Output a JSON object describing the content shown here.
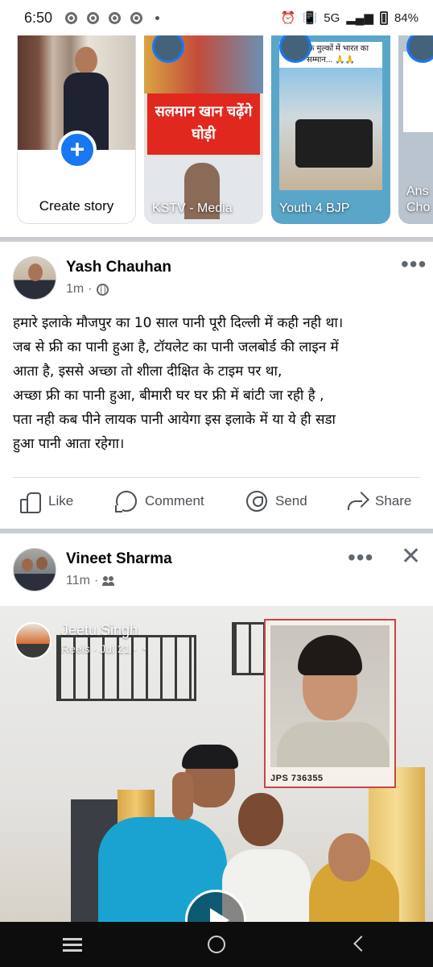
{
  "status_bar": {
    "time": "6:50",
    "network": "5G",
    "battery": "84%"
  },
  "stories": {
    "create_label": "Create story",
    "items": [
      {
        "name": "KSTV - Media",
        "banner": "सलमान खान चढ़ेंगे घोड़ी"
      },
      {
        "name": "Youth 4 BJP",
        "caption": "शहर के मुल्कों में भारत का सम्मान... 🙏🙏"
      },
      {
        "name": "Ans Cho"
      }
    ]
  },
  "posts": [
    {
      "author": "Yash Chauhan",
      "time": "1m",
      "privacy_icon": "globe-icon",
      "lines": [
        "हमारे इलाके मौजपुर का 10 साल पानी पूरी दिल्ली में कही नही था।",
        "जब से फ्री का पानी हुआ है, टॉयलेट का पानी जलबोर्ड की लाइन में",
        "आता है, इससे अच्छा तो शीला दीक्षित के टाइम पर था,",
        "अच्छा फ्री का पानी हुआ, बीमारी घर घर फ्री में बांटी जा रही है ,",
        "पता नही कब पीने लायक पानी आयेगा इस इलाके में या ये ही सडा",
        "हुआ पानी आता रहेगा।"
      ],
      "actions": {
        "like": "Like",
        "comment": "Comment",
        "send": "Send",
        "share": "Share"
      }
    },
    {
      "author": "Vineet Sharma",
      "time": "11m",
      "privacy_icon": "friends-icon",
      "reel": {
        "author": "Jeetu Singh",
        "sub": "Reels · Jul 21 · ",
        "photo_label": "JPS 736355"
      }
    }
  ],
  "colors": {
    "brand": "#1877f2",
    "divider": "#c9ccd1",
    "text_secondary": "#65676b"
  }
}
